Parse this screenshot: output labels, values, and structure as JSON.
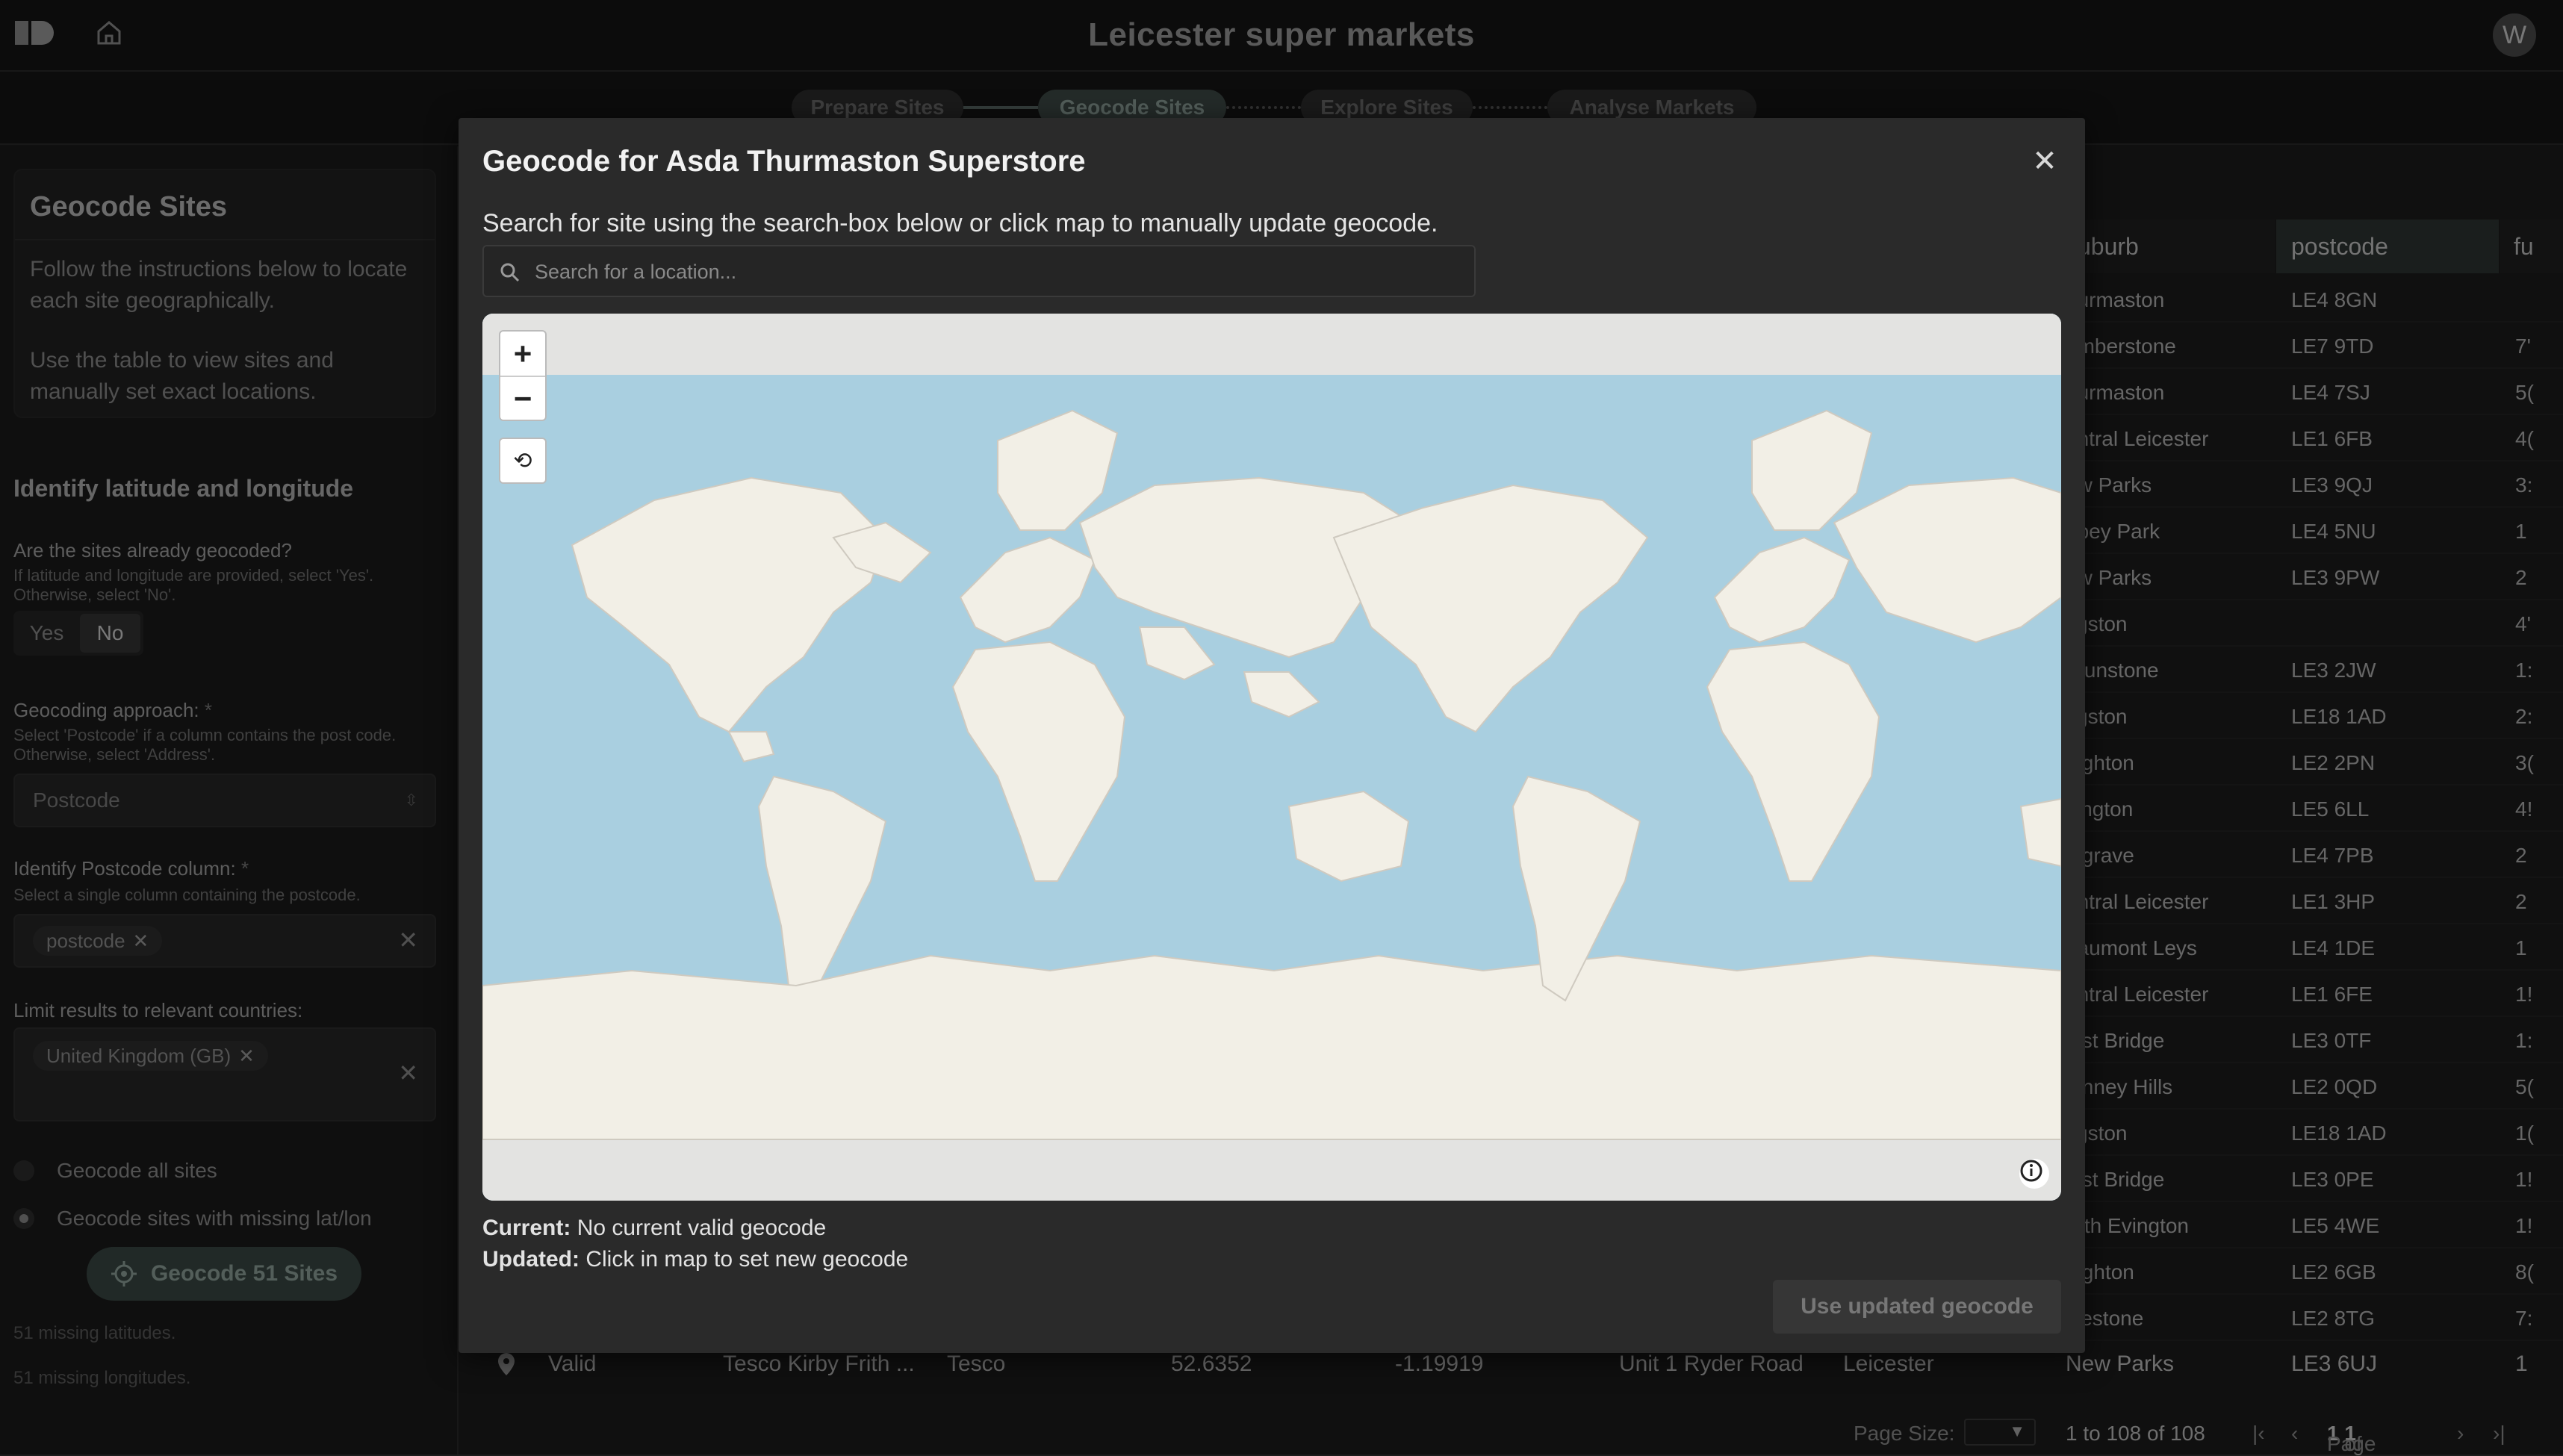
{
  "header": {
    "title": "Leicester super markets",
    "avatar_initial": "W"
  },
  "stepper": {
    "steps": [
      "Prepare Sites",
      "Geocode Sites",
      "Explore Sites",
      "Analyse Markets"
    ],
    "active": 1
  },
  "left_panel": {
    "card_title": "Geocode Sites",
    "card_text_1": "Follow the instructions below to locate each site geographically.",
    "card_text_2": "Use the table to view sites and manually set exact locations.",
    "section_title": "Identify latitude and longitude",
    "q_geocoded_label": "Are the sites already geocoded?",
    "q_geocoded_help": "If latitude and longitude are provided, select 'Yes'. Otherwise, select 'No'.",
    "toggle_yes": "Yes",
    "toggle_no": "No",
    "approach_label": "Geocoding approach:",
    "approach_help": "Select 'Postcode' if a column contains the post code. Otherwise, select 'Address'.",
    "approach_value": "Postcode",
    "postcode_col_label": "Identify Postcode column:",
    "postcode_col_help": "Select a single column containing the postcode.",
    "postcode_col_chip": "postcode",
    "countries_label": "Limit results to relevant countries:",
    "countries_chip": "United Kingdom (GB)",
    "radio_all": "Geocode all sites",
    "radio_missing": "Geocode sites with missing lat/lon",
    "geocode_button": "Geocode 51 Sites",
    "missing_lat": "51 missing latitudes.",
    "missing_lon": "51 missing longitudes.",
    "required_mark": "*"
  },
  "table": {
    "headers": {
      "suburb": "uburb",
      "postcode": "postcode",
      "fu": "fu"
    },
    "rows": [
      [
        "hurmaston",
        "LE4 8GN",
        ""
      ],
      [
        "umberstone",
        "LE7 9TD",
        "7'"
      ],
      [
        "hurmaston",
        "LE4 7SJ",
        "5("
      ],
      [
        "entral Leicester",
        "LE1 6FB",
        "4("
      ],
      [
        "ew Parks",
        "LE3 9QJ",
        "3:"
      ],
      [
        "bbey Park",
        "LE4 5NU",
        "1"
      ],
      [
        "ew Parks",
        "LE3 9PW",
        "2"
      ],
      [
        "figston",
        "",
        "4'"
      ],
      [
        "raunstone",
        "LE3 2JW",
        "1:"
      ],
      [
        "figston",
        "LE18 1AD",
        "2:"
      ],
      [
        "nighton",
        "LE2 2PN",
        "3("
      ],
      [
        "vington",
        "LE5 6LL",
        "4!"
      ],
      [
        "elgrave",
        "LE4 7PB",
        "2"
      ],
      [
        "entral Leicester",
        "LE1 3HP",
        "2"
      ],
      [
        "eaumont Leys",
        "LE4 1DE",
        "1"
      ],
      [
        "entral Leicester",
        "LE1 6FE",
        "1!"
      ],
      [
        "lest Bridge",
        "LE3 0TF",
        "1:"
      ],
      [
        "binney Hills",
        "LE2 0QD",
        "5("
      ],
      [
        "figston",
        "LE18 1AD",
        "1("
      ],
      [
        "lest Bridge",
        "LE3 0PE",
        "1!"
      ],
      [
        "orth Evington",
        "LE5 4WE",
        "1!"
      ],
      [
        "nighton",
        "LE2 6GB",
        "8("
      ],
      [
        "ylestone",
        "LE2 8TG",
        "7:"
      ]
    ],
    "bottom_row": {
      "status": "Valid",
      "name": "Tesco Kirby Frith ...",
      "brand": "Tesco",
      "lat": "52.6352",
      "lon": "-1.19919",
      "address": "Unit 1 Ryder Road",
      "city": "Leicester",
      "suburb": "New Parks",
      "postcode": "LE3 6UJ",
      "fu": "1"
    },
    "footer": {
      "page_size_label": "Page Size:",
      "range": "1 to 108 of 108",
      "page_text": "Page",
      "page_num": "1",
      "of_text": "of",
      "page_total": "1"
    }
  },
  "modal": {
    "title": "Geocode for Asda Thurmaston Superstore",
    "instructions": "Search for site using the search-box below or click map to manually update geocode.",
    "search_placeholder": "Search for a location...",
    "zoom_in": "+",
    "zoom_out": "−",
    "reset": "⟲",
    "current_label": "Current:",
    "current_value": "No current valid geocode",
    "updated_label": "Updated:",
    "updated_value": "Click in map to set new geocode",
    "use_button": "Use updated geocode"
  },
  "colors": {
    "map_water": "#a9cfe0",
    "map_land": "#f2efe6",
    "accent": "#3a4844"
  }
}
